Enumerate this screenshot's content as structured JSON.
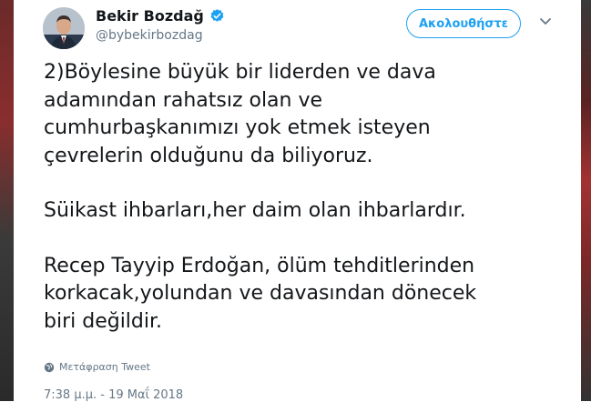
{
  "author": {
    "name": "Bekir Bozdağ",
    "handle": "@bybekirbozdag",
    "verified": true
  },
  "actions": {
    "follow_label": "Ακολουθήστε"
  },
  "tweet": {
    "paragraphs": [
      "2)Böylesine büyük bir liderden ve dava\nadamından rahatsız olan ve\ncumhurbaşkanımızı yok etmek isteyen\nçevrelerin olduğunu da biliyoruz.",
      "Süikast ihbarları,her daim olan ihbarlardır.",
      "Recep Tayyip Erdoğan, ölüm tehditlerinden\nkorkacak,yolundan ve davasından dönecek\nbiri değildir."
    ],
    "translate_label": "Μετάφραση Tweet",
    "timestamp": "7:38 μ.μ. - 19 Μαΐ 2018"
  },
  "colors": {
    "accent": "#1da1f2",
    "text": "#14171a",
    "secondary": "#657786"
  },
  "icons": {
    "verified": "verified-badge-icon",
    "more": "chevron-down-icon",
    "translate": "globe-icon"
  }
}
